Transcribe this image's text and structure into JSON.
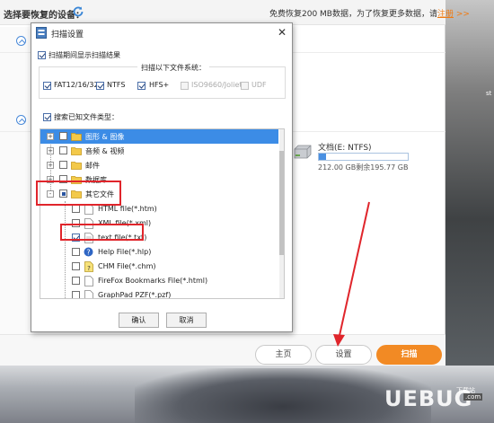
{
  "app": {
    "title": "选择要恢复的设备：",
    "promo_text": "免费恢复200 MB数据，为了恢复更多数据，请",
    "promo_link": "注册",
    "promo_arrow": ">>",
    "drive": {
      "name": "文档(E: NTFS)",
      "size_text": "212.00 GB剩余195.77 GB",
      "used_fraction": 0.08
    },
    "buttons": {
      "home": "主页",
      "settings": "设置",
      "scan": "扫描"
    }
  },
  "dialog": {
    "title": "扫描设置",
    "show_results_label": "扫描期间显示扫描结果",
    "fs_group_title": "扫描以下文件系统：",
    "filesystems": [
      {
        "label": "FAT12/16/32",
        "checked": true,
        "enabled": true
      },
      {
        "label": "NTFS",
        "checked": true,
        "enabled": true
      },
      {
        "label": "HFS+",
        "checked": true,
        "enabled": true
      },
      {
        "label": "ISO9660/Joliet",
        "checked": false,
        "enabled": false
      },
      {
        "label": "UDF",
        "checked": false,
        "enabled": false
      }
    ],
    "search_known_label": "搜索已知文件类型：",
    "tree": [
      {
        "label": "图形 & 图像",
        "expand": "+",
        "selected": true
      },
      {
        "label": "音频 & 视频",
        "expand": "+"
      },
      {
        "label": "邮件",
        "expand": "+"
      },
      {
        "label": "数据库",
        "expand": "+"
      },
      {
        "label": "其它文件",
        "expand": "-"
      },
      {
        "label": "HTML file(*.htm)"
      },
      {
        "label": "XML file(*.xml)"
      },
      {
        "label": "text file(*.txt)",
        "checked": true
      },
      {
        "label": "Help File(*.hlp)"
      },
      {
        "label": "CHM File(*.chm)"
      },
      {
        "label": "FireFox Bookmarks File(*.html)"
      },
      {
        "label": "GraphPad PZF(*.pzf)"
      }
    ],
    "ok_label": "确认",
    "cancel_label": "取消"
  },
  "side_text": "st",
  "watermark": {
    "text": "UEBUG",
    "sub": "下载站",
    "sub2": ".com"
  },
  "colors": {
    "accent_orange": "#f28a24",
    "selection_blue": "#3c8ce6",
    "annotation_red": "#e0252b"
  }
}
